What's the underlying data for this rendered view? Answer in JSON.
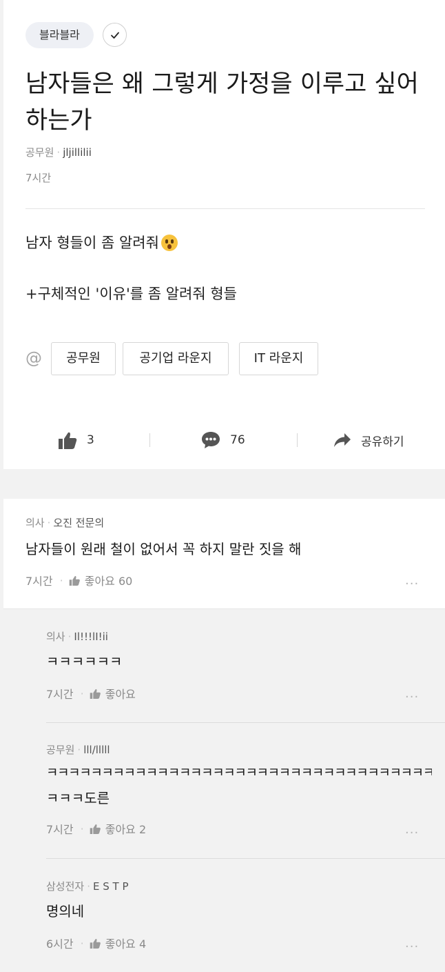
{
  "post": {
    "channel_chip": "블라블라",
    "title": "남자들은 왜 그렇게 가정을 이루고 싶어 하는가",
    "author_company": "공무원",
    "author_nick": "jljillilii",
    "time": "7시간",
    "body_line1": "남자 형들이 좀 알려줘",
    "body_line2": "+구체적인 '이유'를 좀 알려줘 형들",
    "mention_symbol": "@",
    "tags": [
      "공무원",
      "공기업 라운지",
      "IT 라운지"
    ],
    "likes": "3",
    "comments": "76",
    "share_label": "공유하기"
  },
  "comments": [
    {
      "company": "의사",
      "nick": "오진 전문의",
      "text": "남자들이 원래 철이 없어서 꼭 하지 말란 짓을 해",
      "time": "7시간",
      "like_text": "좋아요 60"
    }
  ],
  "replies": [
    {
      "company": "의사",
      "nick": "Il!!!lI!ii",
      "text": "ㅋㅋㅋㅋㅋㅋ",
      "time": "7시간",
      "like_text": "좋아요"
    },
    {
      "company": "공무원",
      "nick": "lll/lllll",
      "text": "ㅋㅋㅋㅋㅋㅋㅋㅋㅋㅋㅋㅋㅋㅋㅋㅋㅋㅋㅋㅋㅋㅋㅋㅋㅋㅋㅋㅋㅋㅋㅋㅋㅋㅋㅋ",
      "text2": "ㅋㅋㅋ도른",
      "time": "7시간",
      "like_text": "좋아요 2"
    },
    {
      "company": "삼성전자",
      "nick": "E S T P",
      "text": "명의네",
      "time": "6시간",
      "like_text": "좋아요 4"
    }
  ],
  "more_label": "...",
  "colors": {
    "chip_bg": "#eef0f5",
    "icon_gray": "#555555",
    "reply_bg": "#f2f2f2"
  }
}
